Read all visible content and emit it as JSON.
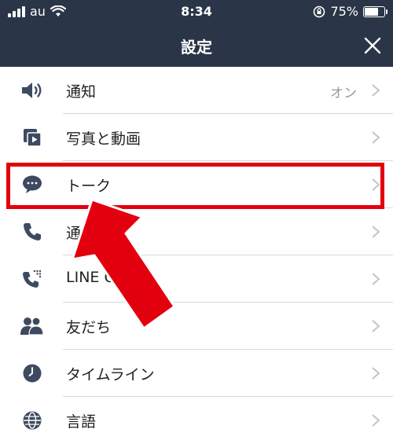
{
  "status_bar": {
    "carrier": "au",
    "time": "8:34",
    "battery_percent": "75%",
    "battery_level": 0.75,
    "icons": [
      "signal-icon",
      "wifi-icon",
      "orientation-lock-icon",
      "battery-icon"
    ]
  },
  "header": {
    "title": "設定",
    "close_icon": "close-icon"
  },
  "settings": {
    "items": [
      {
        "label": "通知",
        "value": "オン",
        "icon": "speaker-icon"
      },
      {
        "label": "写真と動画",
        "value": "",
        "icon": "photo-video-icon"
      },
      {
        "label": "トーク",
        "value": "",
        "icon": "chat-bubble-icon"
      },
      {
        "label": "通話",
        "value": "",
        "icon": "phone-icon"
      },
      {
        "label": "LINE Out",
        "value": "",
        "icon": "line-out-icon"
      },
      {
        "label": "友だち",
        "value": "",
        "icon": "friends-icon"
      },
      {
        "label": "タイムライン",
        "value": "",
        "icon": "clock-icon"
      },
      {
        "label": "言語",
        "value": "",
        "icon": "globe-icon"
      }
    ]
  },
  "colors": {
    "header_bg": "#2a3547",
    "icon": "#3d4a60",
    "highlight": "#e3000e"
  }
}
